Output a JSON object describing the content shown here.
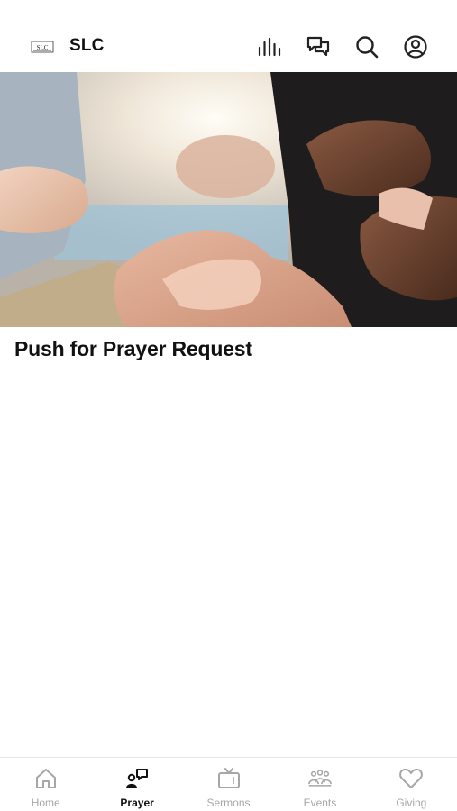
{
  "header": {
    "app_title": "SLC",
    "logo_icon": "church-logo-icon",
    "actions": [
      {
        "icon": "audio-bars-icon"
      },
      {
        "icon": "chat-icon"
      },
      {
        "icon": "search-icon"
      },
      {
        "icon": "profile-icon"
      }
    ]
  },
  "main": {
    "hero_image": "praying-hands-photo",
    "title": "Push for Prayer Request"
  },
  "tabbar": {
    "active_color": "#111111",
    "inactive_color": "#a6a6a6",
    "tabs": [
      {
        "label": "Home",
        "icon": "home-icon",
        "active": false
      },
      {
        "label": "Prayer",
        "icon": "prayer-icon",
        "active": true
      },
      {
        "label": "Sermons",
        "icon": "tv-icon",
        "active": false
      },
      {
        "label": "Events",
        "icon": "people-icon",
        "active": false
      },
      {
        "label": "Giving",
        "icon": "heart-icon",
        "active": false
      }
    ]
  }
}
